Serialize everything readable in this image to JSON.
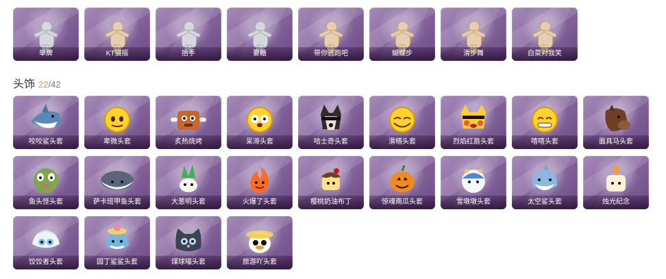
{
  "emotes": [
    {
      "label": "举牌",
      "icon": "sign-hold-icon",
      "variant": "silver"
    },
    {
      "label": "KT猫摇",
      "icon": "kt-cat-dance-icon",
      "variant": "gold"
    },
    {
      "label": "抬手",
      "icon": "raise-hand-icon",
      "variant": "silver"
    },
    {
      "label": "要糖",
      "icon": "ask-candy-icon",
      "variant": "silver"
    },
    {
      "label": "带你逃跑吧",
      "icon": "run-away-icon",
      "variant": "gold"
    },
    {
      "label": "蝴蝶步",
      "icon": "butterfly-step-icon",
      "variant": "gold"
    },
    {
      "label": "滑步舞",
      "icon": "slide-dance-icon",
      "variant": "gold"
    },
    {
      "label": "白菜对我笑",
      "icon": "cabbage-smile-icon",
      "variant": "gold"
    }
  ],
  "section": {
    "title": "头饰",
    "owned": "22",
    "total": "/42"
  },
  "headgear": [
    {
      "label": "咬咬鲨头套",
      "icon": "shark-head-icon",
      "kind": "shark"
    },
    {
      "label": "卑微头套",
      "icon": "shy-emoji-head-icon",
      "kind": "shy"
    },
    {
      "label": "炙热烧烤",
      "icon": "bbq-head-icon",
      "kind": "bbq"
    },
    {
      "label": "呆滞头套",
      "icon": "dazed-emoji-head-icon",
      "kind": "dazed"
    },
    {
      "label": "哈士奇头套",
      "icon": "husky-head-icon",
      "kind": "husky"
    },
    {
      "label": "滑稽头套",
      "icon": "funny-emoji-head-icon",
      "kind": "funny"
    },
    {
      "label": "烈焰红唇头套",
      "icon": "pikachu-lips-head-icon",
      "kind": "pikachu"
    },
    {
      "label": "嘻嘻头套",
      "icon": "grin-emoji-head-icon",
      "kind": "grin"
    },
    {
      "label": "面具马头套",
      "icon": "horse-mask-head-icon",
      "kind": "horse"
    },
    {
      "label": "鱼头怪头套",
      "icon": "fish-monster-head-icon",
      "kind": "fishmonster"
    },
    {
      "label": "萨卡班甲鱼头套",
      "icon": "sacabambaspis-head-icon",
      "kind": "sacaban"
    },
    {
      "label": "大葱明头套",
      "icon": "scallion-head-icon",
      "kind": "scallion"
    },
    {
      "label": "火爆了头套",
      "icon": "fire-head-icon",
      "kind": "fire"
    },
    {
      "label": "樱桃奶油布丁",
      "icon": "pudding-head-icon",
      "kind": "pudding"
    },
    {
      "label": "惊魂南瓜头套",
      "icon": "pumpkin-head-icon",
      "kind": "pumpkin"
    },
    {
      "label": "雪墩墩头套",
      "icon": "snow-doll-head-icon",
      "kind": "snow"
    },
    {
      "label": "太空鲨头套",
      "icon": "space-shark-head-icon",
      "kind": "spaceshark"
    },
    {
      "label": "烛光纪念",
      "icon": "candle-head-icon",
      "kind": "candle"
    },
    {
      "label": "饺饺者头套",
      "icon": "dumpling-head-icon",
      "kind": "dumpling"
    },
    {
      "label": "园丁鲨鲨头套",
      "icon": "gardener-shark-head-icon",
      "kind": "gardener"
    },
    {
      "label": "煤球喵头套",
      "icon": "coal-cat-head-icon",
      "kind": "cat"
    },
    {
      "label": "旅游吖头套",
      "icon": "tourist-duck-head-icon",
      "kind": "tourist"
    }
  ]
}
